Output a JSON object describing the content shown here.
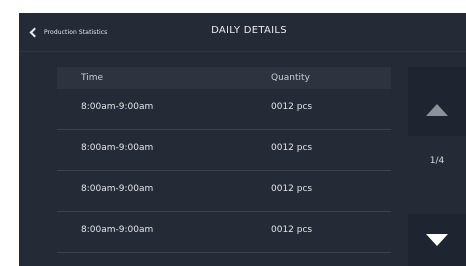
{
  "header": {
    "back_label": "Production Statistics",
    "title": "DAILY DETAILS"
  },
  "table": {
    "columns": [
      "Time",
      "Quantity"
    ],
    "rows": [
      {
        "time": "8:00am-9:00am",
        "quantity": "0012 pcs"
      },
      {
        "time": "8:00am-9:00am",
        "quantity": "0012 pcs"
      },
      {
        "time": "8:00am-9:00am",
        "quantity": "0012 pcs"
      },
      {
        "time": "8:00am-9:00am",
        "quantity": "0012 pcs"
      }
    ]
  },
  "pager": {
    "indicator": "1/4",
    "up_icon": "triangle-up-icon",
    "down_icon": "triangle-down-icon"
  },
  "colors": {
    "background": "#252b36",
    "header_row": "#2d3440",
    "nav_button": "#1f2530",
    "text": "#e2e6eb"
  }
}
